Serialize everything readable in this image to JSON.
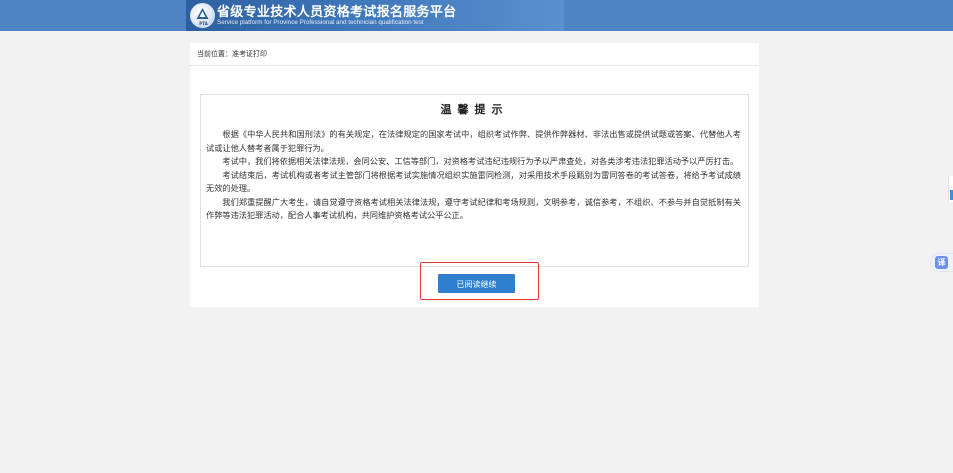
{
  "header": {
    "title": "省级专业技术人员资格考试报名服务平台",
    "subtitle": "Service platform for Province Professional and technician qualification test",
    "logo_text": "PTA"
  },
  "breadcrumb": "当前位置：准考证打印",
  "notice": {
    "title": "温馨提示",
    "paragraphs": [
      "根据《中华人民共和国刑法》的有关规定，在法律规定的国家考试中，组织考试作弊、提供作弊器材、非法出售或提供试题或答案、代替他人考试或让他人替考者属于犯罪行为。",
      "考试中，我们将依据相关法律法规，会同公安、工信等部门，对资格考试违纪违规行为予以严肃查处，对各类涉考违法犯罪活动予以严厉打击。",
      "考试结束后，考试机构或者考试主管部门将根据考试实施情况组织实施雷同检测，对采用技术手段甄别为雷同答卷的考试答卷，将给予考试成绩无效的处理。",
      "我们郑重提醒广大考生，请自觉遵守资格考试相关法律法规，遵守考试纪律和考场规则，文明参考，诚信参考，不组织、不参与并自觉抵制有关作弊等违法犯罪活动，配合人事考试机构，共同维护资格考试公平公正。"
    ]
  },
  "actions": {
    "confirm_label": "已阅读继续"
  },
  "floating": {
    "translate_label": "译"
  },
  "colors": {
    "top_bar": "#4e84c4",
    "button": "#2f7fce",
    "highlight_border": "#e8393a"
  }
}
